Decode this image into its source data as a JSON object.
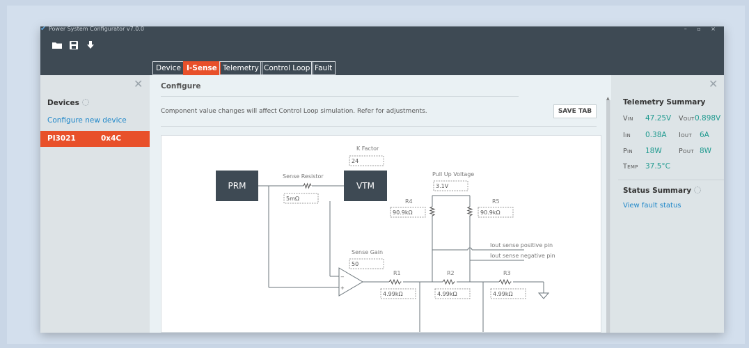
{
  "app": {
    "title": "Power System Configurator v7.0.0",
    "window_controls": "– ▫ ×"
  },
  "toolbar": {
    "icons": [
      "folder-icon",
      "save-icon",
      "download-icon"
    ]
  },
  "tabs": [
    {
      "label": "Device",
      "active": false
    },
    {
      "label": "I-Sense",
      "active": true
    },
    {
      "label": "Telemetry",
      "active": false
    },
    {
      "label": "Control Loop",
      "active": false
    },
    {
      "label": "Fault",
      "active": false
    }
  ],
  "left_panel": {
    "devices_label": "Devices",
    "configure_link": "Configure new device",
    "device": {
      "name": "PI3021",
      "address": "0x4C"
    }
  },
  "main": {
    "section_title": "Configure",
    "notice": "Component value changes will affect Control Loop simulation. Refer for adjustments.",
    "save_button": "SAVE TAB"
  },
  "schematic": {
    "prm": "PRM",
    "vtm": "VTM",
    "sense_resistor_label": "Sense Resistor",
    "sense_resistor_value": "5mΩ",
    "k_factor_label": "K Factor",
    "k_factor_value": "24",
    "pull_up_label": "Pull Up Voltage",
    "pull_up_value": "3.1V",
    "r4_label": "R4",
    "r4_value": "90.9kΩ",
    "r5_label": "R5",
    "r5_value": "90.9kΩ",
    "iout_pos": "Iout sense positive pin",
    "iout_neg": "Iout sense negative pin",
    "sense_gain_label": "Sense Gain",
    "sense_gain_value": "50",
    "r1_label": "R1",
    "r1_value": "4.99kΩ",
    "r2_label": "R2",
    "r2_value": "4.99kΩ",
    "r3_label": "R3",
    "r3_value": "4.99kΩ",
    "opamp_minus": "−",
    "opamp_plus": "+"
  },
  "right_panel": {
    "telemetry_title": "Telemetry Summary",
    "vin_label": "Vin",
    "vin_value": "47.25V",
    "vout_label": "Vout",
    "vout_value": "0.898V",
    "iin_label": "Iin",
    "iin_value": "0.38A",
    "iout_label": "Iout",
    "iout_value": "6A",
    "pin_label": "Pin",
    "pin_value": "18W",
    "pout_label": "Pout",
    "pout_value": "8W",
    "temp_label": "Temp",
    "temp_value": "37.5°C",
    "status_title": "Status Summary",
    "fault_link": "View fault status"
  },
  "colors": {
    "accent": "#e8502a",
    "link": "#1f87c9",
    "value": "#1f9a8f",
    "titlebar": "#3e4a54",
    "block": "#3e4a54"
  }
}
